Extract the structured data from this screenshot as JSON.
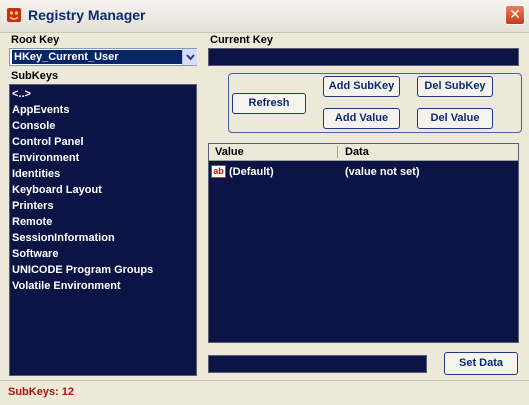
{
  "window": {
    "title": "Registry Manager",
    "close_glyph": "✕"
  },
  "labels": {
    "root_key": "Root Key",
    "current_key": "Current Key",
    "subkeys": "SubKeys"
  },
  "root_key": {
    "selected": "HKey_Current_User",
    "dropdown_glyph": "⌄"
  },
  "current_key": {
    "value": ""
  },
  "subkeys": [
    "<..>",
    "AppEvents",
    "Console",
    "Control Panel",
    "Environment",
    "Identities",
    "Keyboard Layout",
    "Printers",
    "Remote",
    "SessionInformation",
    "Software",
    "UNICODE Program Groups",
    "Volatile Environment"
  ],
  "buttons": {
    "refresh": "Refresh",
    "add_subkey": "Add SubKey",
    "del_subkey": "Del SubKey",
    "add_value": "Add Value",
    "del_value": "Del Value",
    "set_data": "Set Data"
  },
  "values_table": {
    "columns": [
      "Value",
      "Data"
    ],
    "rows": [
      {
        "icon": "string-value-icon",
        "icon_text": "ab",
        "value": "(Default)",
        "data": "(value not set)"
      }
    ]
  },
  "data_field": {
    "value": ""
  },
  "status": {
    "text": "SubKeys: 12"
  },
  "colors": {
    "list_bg": "#0c1446",
    "selection": "#0a246a",
    "status_text": "#b01010",
    "title_text": "#0b2a6f"
  }
}
